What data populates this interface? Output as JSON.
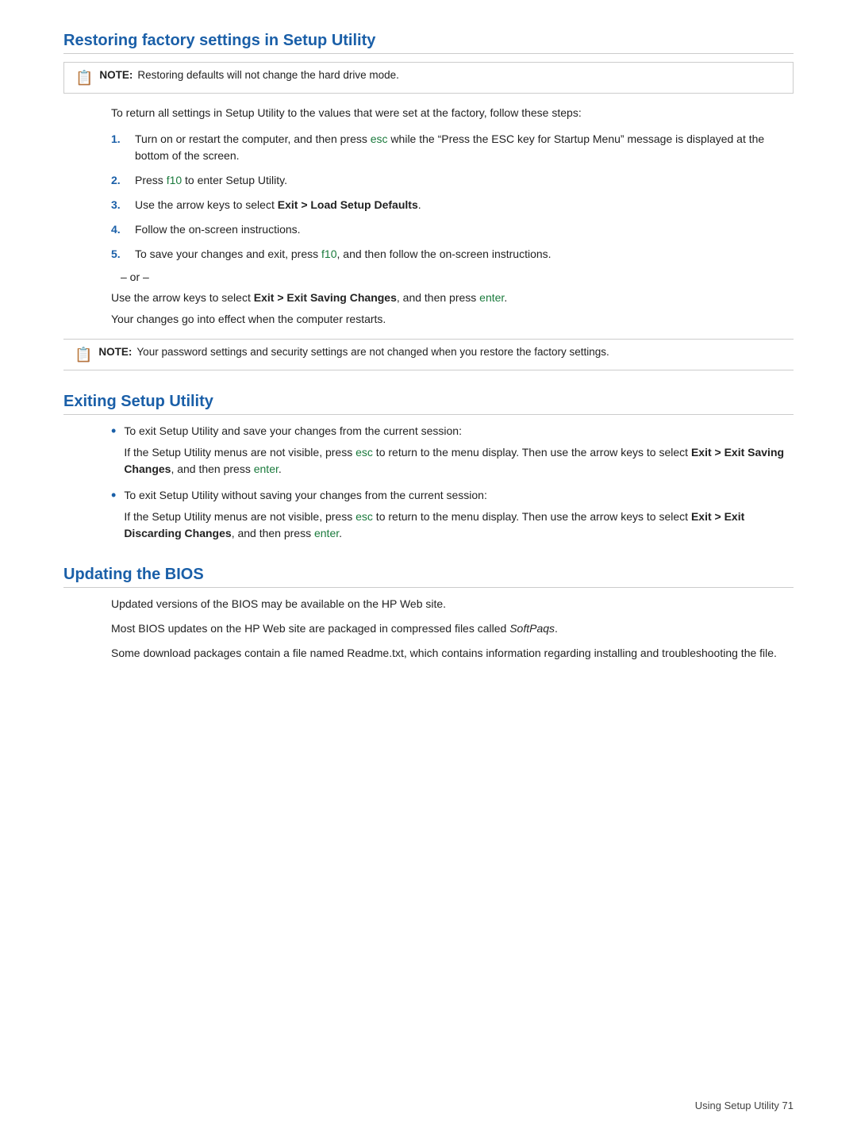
{
  "page": {
    "footer": "Using Setup Utility    71"
  },
  "restoring": {
    "heading": "Restoring factory settings in Setup Utility",
    "note1": {
      "label": "NOTE:",
      "text": "Restoring defaults will not change the hard drive mode."
    },
    "intro": "To return all settings in Setup Utility to the values that were set at the factory, follow these steps:",
    "steps": [
      {
        "num": "1.",
        "text_before": "Turn on or restart the computer, and then press ",
        "link1": "esc",
        "text_middle": " while the “Press the ESC key for Startup Menu” message is displayed at the bottom of the screen.",
        "link2": "",
        "text_after": ""
      },
      {
        "num": "2.",
        "text_before": "Press ",
        "link1": "f10",
        "text_after": " to enter Setup Utility."
      },
      {
        "num": "3.",
        "text_plain": "Use the arrow keys to select ",
        "bold": "Exit > Load Setup Defaults",
        "text_end": "."
      },
      {
        "num": "4.",
        "text_plain": "Follow the on-screen instructions."
      },
      {
        "num": "5.",
        "text_before": "To save your changes and exit, press ",
        "link1": "f10",
        "text_middle": ", and then follow the on-screen instructions."
      }
    ],
    "or_line": "– or –",
    "arrow_keys_text_before": "Use the arrow keys to select ",
    "arrow_keys_bold": "Exit > Exit Saving Changes",
    "arrow_keys_text_middle": ", and then press ",
    "arrow_keys_link": "enter",
    "arrow_keys_text_end": ".",
    "changes_text": "Your changes go into effect when the computer restarts.",
    "note2": {
      "label": "NOTE:",
      "text": "Your password settings and security settings are not changed when you restore the factory settings."
    }
  },
  "exiting": {
    "heading": "Exiting Setup Utility",
    "bullets": [
      {
        "main": "To exit Setup Utility and save your changes from the current session:",
        "sub_before": "If the Setup Utility menus are not visible, press ",
        "sub_link1": "esc",
        "sub_middle": " to return to the menu display. Then use the arrow keys to select ",
        "sub_bold": "Exit > Exit Saving Changes",
        "sub_middle2": ", and then press ",
        "sub_link2": "enter",
        "sub_end": "."
      },
      {
        "main": "To exit Setup Utility without saving your changes from the current session:",
        "sub_before": "If the Setup Utility menus are not visible, press ",
        "sub_link1": "esc",
        "sub_middle": " to return to the menu display. Then use the arrow keys to select ",
        "sub_bold": "Exit > Exit Discarding Changes",
        "sub_middle2": ", and then press ",
        "sub_link2": "enter",
        "sub_end": "."
      }
    ]
  },
  "updating": {
    "heading": "Updating the BIOS",
    "para1": "Updated versions of the BIOS may be available on the HP Web site.",
    "para2": "Most BIOS updates on the HP Web site are packaged in compressed files called ",
    "para2_italic": "SoftPaqs",
    "para2_end": ".",
    "para3": "Some download packages contain a file named Readme.txt, which contains information regarding installing and troubleshooting the file."
  },
  "colors": {
    "heading": "#1a5fa8",
    "link": "#1a7a3c",
    "bullet": "#1a5fa8"
  }
}
